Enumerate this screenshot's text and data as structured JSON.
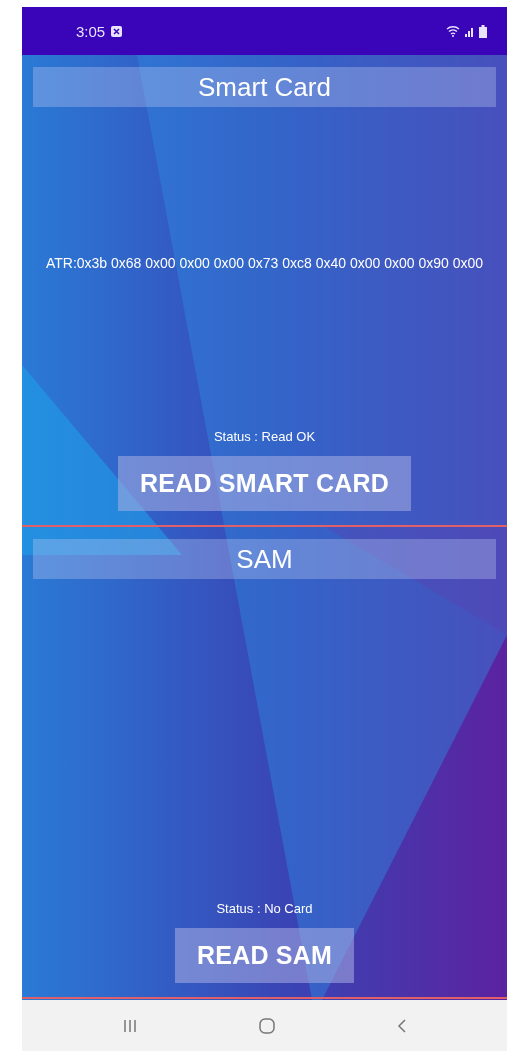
{
  "status_bar": {
    "time": "3:05"
  },
  "sections": [
    {
      "title": "Smart Card",
      "data": "ATR:0x3b 0x68 0x00 0x00 0x00 0x73 0xc8 0x40 0x00 0x00 0x90 0x00",
      "status": "Status : Read OK",
      "button": "READ SMART CARD"
    },
    {
      "title": "SAM",
      "status": "Status : No Card",
      "button": "READ SAM"
    }
  ]
}
